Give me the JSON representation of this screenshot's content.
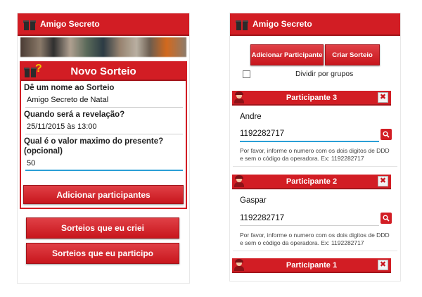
{
  "app_title": "Amigo Secreto",
  "left": {
    "form_title": "Novo Sorteio",
    "fields": [
      {
        "label": "Dê um nome ao Sorteio",
        "value": "Amigo Secreto de Natal"
      },
      {
        "label": "Quando será a revelação?",
        "value": "25/11/2015 às 13:00"
      },
      {
        "label": "Qual é o valor maximo do presente? (opcional)",
        "value": "50"
      }
    ],
    "add_button": "Adicionar participantes",
    "my_draws_button": "Sorteios que eu criei",
    "joined_draws_button": "Sorteios que eu participo"
  },
  "right": {
    "tabs": [
      "Adicionar Participante",
      "Criar Sorteio"
    ],
    "group_label": "Dividir por grupos",
    "hint": "Por favor, informe o numero com os dois digitos de DDD e sem o código da operadora. Ex: 1192282717",
    "close_glyph": "✖",
    "participants": [
      {
        "title": "Participante 3",
        "name": "Andre",
        "phone": "1192282717"
      },
      {
        "title": "Participante 2",
        "name": "Gaspar",
        "phone": "1192282717"
      },
      {
        "title": "Participante 1"
      }
    ]
  },
  "colors": {
    "accent": "#d21d24",
    "focus": "#2a9fd6",
    "question_mark": "#f2c200"
  },
  "icons": [
    "gift-icon",
    "question-mark-icon",
    "avatar-icon",
    "close-icon",
    "search-icon"
  ]
}
